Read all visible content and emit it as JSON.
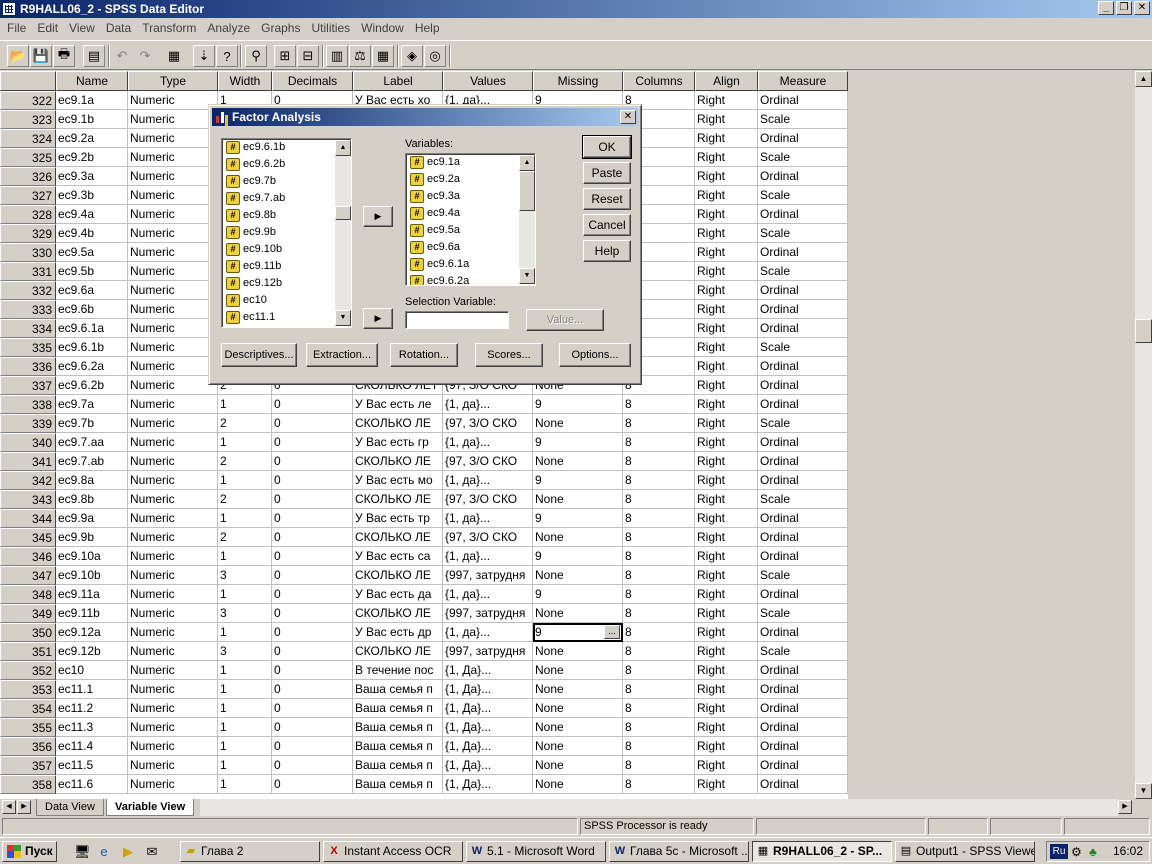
{
  "window": {
    "title": "R9HALL06_2 - SPSS Data Editor"
  },
  "window_controls": [
    "_",
    "❐",
    "✕"
  ],
  "menu": [
    "File",
    "Edit",
    "View",
    "Data",
    "Transform",
    "Analyze",
    "Graphs",
    "Utilities",
    "Window",
    "Help"
  ],
  "toolbar_icons": [
    "open-icon",
    "save-icon",
    "print-icon",
    "dialog-recall-icon",
    "undo-icon",
    "redo-icon",
    "goto-chart-icon",
    "goto-case-icon",
    "variables-icon",
    "find-icon",
    "insert-case-icon",
    "insert-variable-icon",
    "split-file-icon",
    "weight-cases-icon",
    "select-cases-icon",
    "value-labels-icon",
    "use-sets-icon"
  ],
  "columns": [
    "Name",
    "Type",
    "Width",
    "Decimals",
    "Label",
    "Values",
    "Missing",
    "Columns",
    "Align",
    "Measure"
  ],
  "rows": [
    [
      "322",
      "ec9.1a",
      "Numeric",
      "1",
      "0",
      "У Вас есть хо",
      "{1, да}...",
      "9",
      "8",
      "Right",
      "Ordinal"
    ],
    [
      "323",
      "ec9.1b",
      "Numeric",
      "",
      "",
      "",
      "",
      "",
      "",
      "Right",
      "Scale"
    ],
    [
      "324",
      "ec9.2a",
      "Numeric",
      "",
      "",
      "",
      "",
      "",
      "",
      "Right",
      "Ordinal"
    ],
    [
      "325",
      "ec9.2b",
      "Numeric",
      "",
      "",
      "",
      "",
      "",
      "",
      "Right",
      "Scale"
    ],
    [
      "326",
      "ec9.3a",
      "Numeric",
      "",
      "",
      "",
      "",
      "",
      "",
      "Right",
      "Ordinal"
    ],
    [
      "327",
      "ec9.3b",
      "Numeric",
      "",
      "",
      "",
      "",
      "",
      "",
      "Right",
      "Scale"
    ],
    [
      "328",
      "ec9.4a",
      "Numeric",
      "",
      "",
      "",
      "",
      "",
      "",
      "Right",
      "Ordinal"
    ],
    [
      "329",
      "ec9.4b",
      "Numeric",
      "",
      "",
      "",
      "",
      "",
      "",
      "Right",
      "Scale"
    ],
    [
      "330",
      "ec9.5a",
      "Numeric",
      "",
      "",
      "",
      "",
      "",
      "",
      "Right",
      "Ordinal"
    ],
    [
      "331",
      "ec9.5b",
      "Numeric",
      "",
      "",
      "",
      "",
      "",
      "",
      "Right",
      "Scale"
    ],
    [
      "332",
      "ec9.6a",
      "Numeric",
      "",
      "",
      "",
      "",
      "",
      "",
      "Right",
      "Ordinal"
    ],
    [
      "333",
      "ec9.6b",
      "Numeric",
      "",
      "",
      "",
      "",
      "",
      "",
      "Right",
      "Ordinal"
    ],
    [
      "334",
      "ec9.6.1a",
      "Numeric",
      "",
      "",
      "",
      "",
      "",
      "",
      "Right",
      "Ordinal"
    ],
    [
      "335",
      "ec9.6.1b",
      "Numeric",
      "",
      "",
      "",
      "",
      "",
      "",
      "Right",
      "Scale"
    ],
    [
      "336",
      "ec9.6.2a",
      "Numeric",
      "",
      "",
      "",
      "",
      "",
      "",
      "Right",
      "Ordinal"
    ],
    [
      "337",
      "ec9.6.2b",
      "Numeric",
      "2",
      "0",
      "СКОЛЬКО ЛЕТ К",
      "{97, З/О СКО",
      "None",
      "8",
      "Right",
      "Ordinal"
    ],
    [
      "338",
      "ec9.7a",
      "Numeric",
      "1",
      "0",
      "У Вас есть ле",
      "{1, да}...",
      "9",
      "8",
      "Right",
      "Ordinal"
    ],
    [
      "339",
      "ec9.7b",
      "Numeric",
      "2",
      "0",
      "СКОЛЬКО ЛЕ",
      "{97, З/О СКО",
      "None",
      "8",
      "Right",
      "Scale"
    ],
    [
      "340",
      "ec9.7.aa",
      "Numeric",
      "1",
      "0",
      "У Вас есть гр",
      "{1, да}...",
      "9",
      "8",
      "Right",
      "Ordinal"
    ],
    [
      "341",
      "ec9.7.ab",
      "Numeric",
      "2",
      "0",
      "СКОЛЬКО ЛЕ",
      "{97, З/О СКО",
      "None",
      "8",
      "Right",
      "Ordinal"
    ],
    [
      "342",
      "ec9.8a",
      "Numeric",
      "1",
      "0",
      "У Вас есть мо",
      "{1, да}...",
      "9",
      "8",
      "Right",
      "Ordinal"
    ],
    [
      "343",
      "ec9.8b",
      "Numeric",
      "2",
      "0",
      "СКОЛЬКО ЛЕ",
      "{97, З/О СКО",
      "None",
      "8",
      "Right",
      "Scale"
    ],
    [
      "344",
      "ec9.9a",
      "Numeric",
      "1",
      "0",
      "У Вас есть тр",
      "{1, да}...",
      "9",
      "8",
      "Right",
      "Ordinal"
    ],
    [
      "345",
      "ec9.9b",
      "Numeric",
      "2",
      "0",
      "СКОЛЬКО ЛЕ",
      "{97, З/О СКО",
      "None",
      "8",
      "Right",
      "Ordinal"
    ],
    [
      "346",
      "ec9.10a",
      "Numeric",
      "1",
      "0",
      "У Вас есть са",
      "{1, да}...",
      "9",
      "8",
      "Right",
      "Ordinal"
    ],
    [
      "347",
      "ec9.10b",
      "Numeric",
      "3",
      "0",
      "СКОЛЬКО ЛЕ",
      "{997, затрудня",
      "None",
      "8",
      "Right",
      "Scale"
    ],
    [
      "348",
      "ec9.11a",
      "Numeric",
      "1",
      "0",
      "У Вас есть да",
      "{1, да}...",
      "9",
      "8",
      "Right",
      "Ordinal"
    ],
    [
      "349",
      "ec9.11b",
      "Numeric",
      "3",
      "0",
      "СКОЛЬКО ЛЕ",
      "{997, затрудня",
      "None",
      "8",
      "Right",
      "Scale"
    ],
    [
      "350",
      "ec9.12a",
      "Numeric",
      "1",
      "0",
      "У Вас есть др",
      "{1, да}...",
      "9",
      "8",
      "Right",
      "Ordinal"
    ],
    [
      "351",
      "ec9.12b",
      "Numeric",
      "3",
      "0",
      "СКОЛЬКО ЛЕ",
      "{997, затрудня",
      "None",
      "8",
      "Right",
      "Scale"
    ],
    [
      "352",
      "ec10",
      "Numeric",
      "1",
      "0",
      "В течение пос",
      "{1, Да}...",
      "None",
      "8",
      "Right",
      "Ordinal"
    ],
    [
      "353",
      "ec11.1",
      "Numeric",
      "1",
      "0",
      "Ваша семья п",
      "{1, Да}...",
      "None",
      "8",
      "Right",
      "Ordinal"
    ],
    [
      "354",
      "ec11.2",
      "Numeric",
      "1",
      "0",
      "Ваша семья п",
      "{1, Да}...",
      "None",
      "8",
      "Right",
      "Ordinal"
    ],
    [
      "355",
      "ec11.3",
      "Numeric",
      "1",
      "0",
      "Ваша семья п",
      "{1, Да}...",
      "None",
      "8",
      "Right",
      "Ordinal"
    ],
    [
      "356",
      "ec11.4",
      "Numeric",
      "1",
      "0",
      "Ваша семья п",
      "{1, Да}...",
      "None",
      "8",
      "Right",
      "Ordinal"
    ],
    [
      "357",
      "ec11.5",
      "Numeric",
      "1",
      "0",
      "Ваша семья п",
      "{1, Да}...",
      "None",
      "8",
      "Right",
      "Ordinal"
    ],
    [
      "358",
      "ec11.6",
      "Numeric",
      "1",
      "0",
      "Ваша семья п",
      "{1, Да}...",
      "None",
      "8",
      "Right",
      "Ordinal"
    ]
  ],
  "active_cell": {
    "row": "350",
    "column": "Missing",
    "button": "..."
  },
  "tabs": {
    "data_view": "Data View",
    "variable_view": "Variable View"
  },
  "status": {
    "processor": "SPSS Processor  is ready"
  },
  "dialog": {
    "title": "Factor Analysis",
    "source_vars": [
      "ec9.6.1b",
      "ec9.6.2b",
      "ec9.7b",
      "ec9.7.ab",
      "ec9.8b",
      "ec9.9b",
      "ec9.10b",
      "ec9.11b",
      "ec9.12b",
      "ec10",
      "ec11.1"
    ],
    "variables_label": "Variables:",
    "target_vars": [
      "ec9.1a",
      "ec9.2a",
      "ec9.3a",
      "ec9.4a",
      "ec9.5a",
      "ec9.6a",
      "ec9.6.1a",
      "ec9.6.2a"
    ],
    "selection_label": "Selection Variable:",
    "selection_value": "",
    "value_button": "Value...",
    "buttons": {
      "ok": "OK",
      "paste": "Paste",
      "reset": "Reset",
      "cancel": "Cancel",
      "help": "Help"
    },
    "bottom_buttons": [
      "Descriptives...",
      "Extraction...",
      "Rotation...",
      "Scores...",
      "Options..."
    ]
  },
  "taskbar": {
    "start": "Пуск",
    "items": [
      {
        "label": "Глава 2",
        "icon": "folder-icon"
      },
      {
        "label": "Instant Access OCR",
        "icon": "ocr-icon"
      },
      {
        "label": "5.1 - Microsoft Word",
        "icon": "word-icon"
      },
      {
        "label": "Глава 5с - Microsoft ...",
        "icon": "word-icon"
      },
      {
        "label": "R9HALL06_2 - SP...",
        "icon": "spss-icon"
      },
      {
        "label": "Output1 - SPSS Viewer",
        "icon": "spss-viewer-icon"
      }
    ],
    "lang": "Ru",
    "clock": "16:02"
  }
}
